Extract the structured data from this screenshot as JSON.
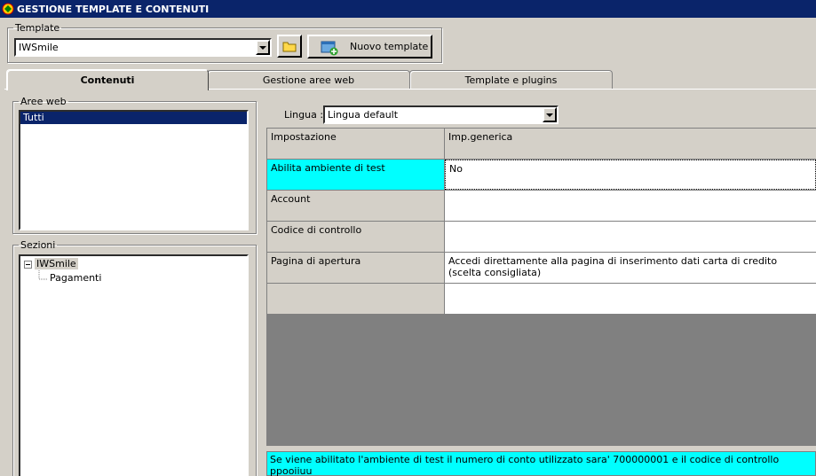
{
  "window": {
    "title": "GESTIONE TEMPLATE E CONTENUTI"
  },
  "template_group": {
    "label": "Template",
    "selected": "IWSmile",
    "new_button_label": "Nuovo template"
  },
  "tabs": [
    {
      "label": "Contenuti"
    },
    {
      "label": "Gestione aree web"
    },
    {
      "label": "Template e plugins"
    }
  ],
  "aree_web": {
    "label": "Aree web",
    "items": [
      "Tutti"
    ]
  },
  "sezioni": {
    "label": "Sezioni",
    "root": "IWSmile",
    "children": [
      "Pagamenti"
    ]
  },
  "lingua": {
    "label": "Lingua :",
    "selected": "Lingua default"
  },
  "grid": {
    "headers": [
      "Impostazione",
      "Imp.generica"
    ],
    "rows": [
      {
        "setting": "Abilita ambiente di test",
        "value": "No"
      },
      {
        "setting": "Account",
        "value": ""
      },
      {
        "setting": "Codice di controllo",
        "value": ""
      },
      {
        "setting": "Pagina di apertura",
        "value": "Accedi direttamente alla pagina di inserimento dati carta di credito (scelta consigliata)"
      },
      {
        "setting": "",
        "value": ""
      }
    ]
  },
  "info_text": "Se viene abilitato l'ambiente di test il numero di conto utilizzato sara' 700000001 e il codice di controllo ppooiiuu",
  "colors": {
    "title_bar": "#0a246a",
    "highlight": "#00ffff",
    "face": "#d4d0c8"
  }
}
